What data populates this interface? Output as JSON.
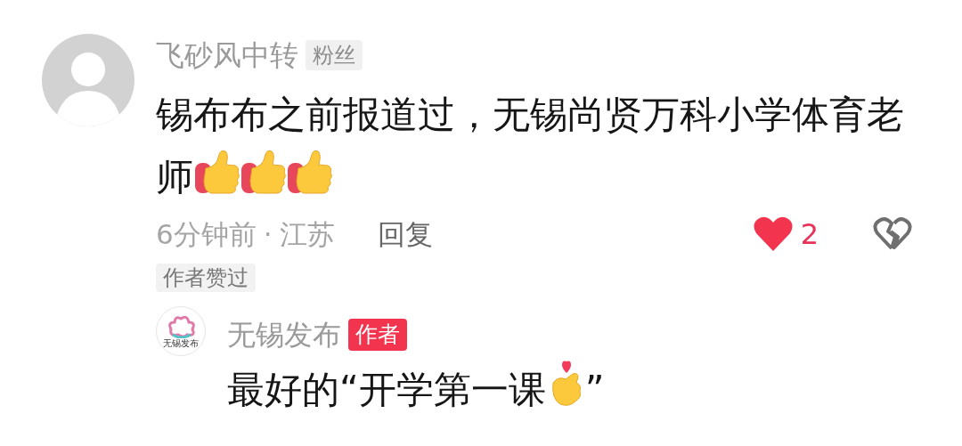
{
  "comment": {
    "author": "飞砂风中转",
    "author_badge": "粉丝",
    "content": [
      {
        "kind": "text",
        "text": "锡布布之前报道过，无锡尚贤万科小学体育老师"
      },
      {
        "kind": "thumbs-up"
      },
      {
        "kind": "thumbs-up"
      },
      {
        "kind": "thumbs-up"
      }
    ],
    "time": "6分钟前",
    "separator": "·",
    "location": "江苏",
    "reply_label": "回复",
    "liked": true,
    "like_count": "2",
    "disliked": false,
    "author_liked_label": "作者赞过"
  },
  "reply": {
    "author": "无锡发布",
    "avatar_caption": "无锡发布",
    "author_badge": "作者",
    "content": [
      {
        "kind": "text",
        "text": "最好的“开学第一课"
      },
      {
        "kind": "finger-heart"
      },
      {
        "kind": "text",
        "text": "”"
      }
    ]
  }
}
